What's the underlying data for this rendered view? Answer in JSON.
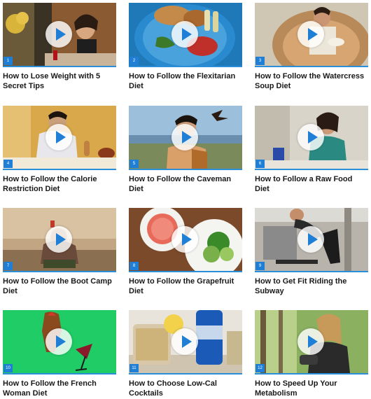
{
  "accent_color": "#1f7fd6",
  "videos": [
    {
      "number": "1",
      "title": "How to Lose Weight with 5 Secret Tips"
    },
    {
      "number": "2",
      "title": "How to Follow the Flexitarian Diet"
    },
    {
      "number": "3",
      "title": "How to Follow the Watercress Soup Diet"
    },
    {
      "number": "4",
      "title": "How to Follow the Calorie Restriction Diet"
    },
    {
      "number": "5",
      "title": "How to Follow the Caveman Diet"
    },
    {
      "number": "6",
      "title": "How to Follow a Raw Food Diet"
    },
    {
      "number": "7",
      "title": "How to Follow the Boot Camp Diet"
    },
    {
      "number": "8",
      "title": "How to Follow the Grapefruit Diet"
    },
    {
      "number": "9",
      "title": "How to Get Fit Riding the Subway"
    },
    {
      "number": "10",
      "title": "How to Follow the French Woman Diet"
    },
    {
      "number": "11",
      "title": "How to Choose Low-Cal Cocktails"
    },
    {
      "number": "12",
      "title": "How to Speed Up Your Metabolism"
    }
  ]
}
